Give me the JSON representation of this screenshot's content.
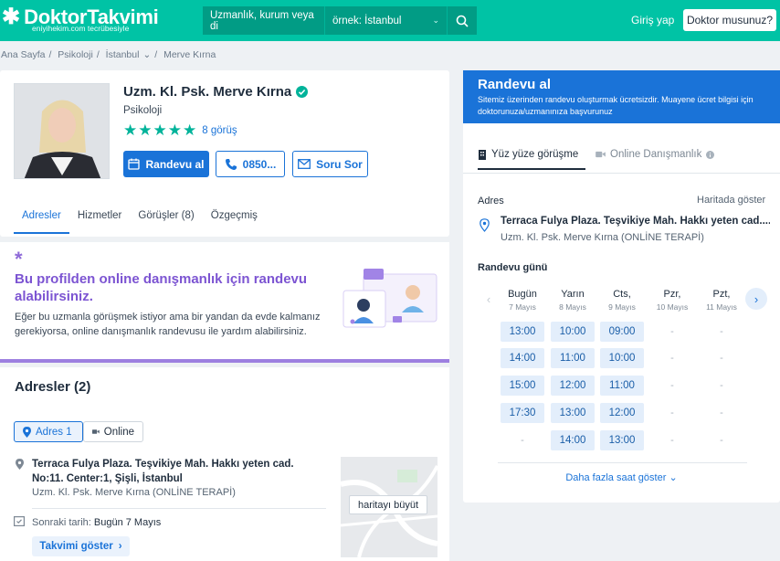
{
  "header": {
    "logo_text": "DoktorTakvimi",
    "logo_sub": "eniyihekim.com tecrübesiyle",
    "search_spec_placeholder": "Uzmanlık, kurum veya di",
    "search_loc_placeholder": "örnek: İstanbul",
    "login_label": "Giriş yap",
    "doctor_label": "Doktor musunuz?",
    "brand_color": "#00c3a5"
  },
  "breadcrumb": [
    "Ana Sayfa",
    "Psikoloji",
    "İstanbul",
    "Merve Kırna"
  ],
  "profile": {
    "name": "Uzm. Kl. Psk. Merve Kırna",
    "specialty": "Psikoloji",
    "rating_stars": 5,
    "opinions": "8 görüş",
    "book_label": "Randevu al",
    "phone_label": "0850...",
    "ask_label": "Soru Sor"
  },
  "tabs": [
    {
      "label": "Adresler",
      "active": true
    },
    {
      "label": "Hizmetler",
      "active": false
    },
    {
      "label": "Görüşler (8)",
      "active": false
    },
    {
      "label": "Özgeçmiş",
      "active": false
    }
  ],
  "online_banner": {
    "title": "Bu profilden online danışmanlık için randevu alabilirsiniz.",
    "text": "Eğer bu uzmanla görüşmek istiyor ama bir yandan da evde kalmanız gerekiyorsa, online danışmanlık randevusu ile yardım alabilirsiniz."
  },
  "addresses": {
    "title": "Adresler (2)",
    "pill_address": "Adres 1",
    "pill_online": "Online",
    "address_line": "Terraca Fulya Plaza. Teşvikiye Mah. Hakkı yeten cad. No:11. Center:1, Şişli, İstanbul",
    "address_sub": "Uzm. Kl. Psk. Merve Kırna (ONLİNE TERAPİ)",
    "next_label": "Sonraki tarih:",
    "next_value": "Bugün 7 Mayıs",
    "calendar_label": "Takvimi göster",
    "map_label": "haritayı büyüt"
  },
  "booking": {
    "title": "Randevu al",
    "subtitle": "Sitemiz üzerinden randevu oluşturmak ücretsizdir. Muayene ücret bilgisi için doktorunuza/uzmanınıza başvurunuz",
    "tab_inperson": "Yüz yüze görüşme",
    "tab_online": "Online Danışmanlık",
    "address_label": "Adres",
    "map_link": "Haritada göster",
    "address": "Terraca Fulya Plaza. Teşvikiye Mah. Hakkı yeten cad....",
    "address_sub": "Uzm. Kl. Psk. Merve Kırna (ONLİNE TERAPİ)",
    "date_label": "Randevu günü",
    "more_label": "Daha fazla saat göster",
    "days": [
      {
        "name": "Bugün",
        "date": "7 Mayıs",
        "slots": [
          "13:00",
          "14:00",
          "15:00",
          "17:30",
          "-"
        ]
      },
      {
        "name": "Yarın",
        "date": "8 Mayıs",
        "slots": [
          "10:00",
          "11:00",
          "12:00",
          "13:00",
          "14:00"
        ]
      },
      {
        "name": "Cts,",
        "date": "9 Mayıs",
        "slots": [
          "09:00",
          "10:00",
          "11:00",
          "12:00",
          "13:00"
        ]
      },
      {
        "name": "Pzr,",
        "date": "10 Mayıs",
        "slots": [
          "-",
          "-",
          "-",
          "-",
          "-"
        ]
      },
      {
        "name": "Pzt,",
        "date": "11 Mayıs",
        "slots": [
          "-",
          "-",
          "-",
          "-",
          "-"
        ]
      }
    ]
  }
}
